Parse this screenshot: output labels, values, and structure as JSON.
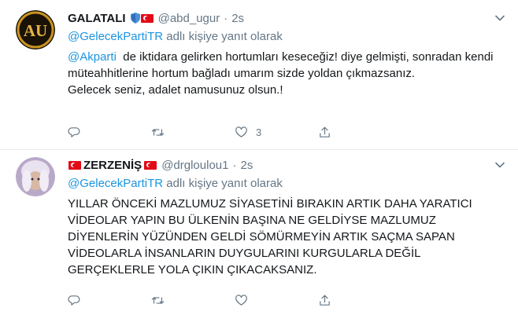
{
  "tweets": [
    {
      "name": "GALATALI",
      "handle": "@abd_ugur",
      "separator": "·",
      "time": "2s",
      "reply_mention": "@GelecekPartiTR",
      "reply_suffix": " adlı kişiye yanıt olarak",
      "text_mention": "@Akparti",
      "text_body": "  de iktidara gelirken hortumları keseceğiz! diye gelmişti, sonradan kendi müteahhitlerine hortum bağladı umarım sizde yoldan çıkmazsanız.\nGelecek seniz, adalet namusunuz olsun.!",
      "avatar_text": "AU",
      "stats": {
        "replies": "",
        "retweets": "",
        "likes": "3"
      }
    },
    {
      "name": "ZERZENİŞ",
      "handle": "@drgloulou1",
      "separator": "·",
      "time": "2s",
      "reply_mention": "@GelecekPartiTR",
      "reply_suffix": " adlı kişiye yanıt olarak",
      "text_body": "YILLAR ÖNCEKİ MAZLUMUZ SİYASETİNİ BIRAKIN ARTIK DAHA YARATICI VİDEOLAR YAPIN BU ÜLKENİN BAŞINA NE GELDİYSE MAZLUMUZ DİYENLERİN YÜZÜNDEN GELDİ SÖMÜRMEYİN ARTIK SAÇMA SAPAN VİDEOLARLA İNSANLARIN DUYGULARINI KURGULARLA DEĞİL GERÇEKLERLE YOLA ÇIKIN ÇIKACAKSANIZ.",
      "stats": {
        "replies": "",
        "retweets": "",
        "likes": ""
      }
    }
  ],
  "colors": {
    "accent": "#1b95e0",
    "muted": "#657786",
    "flag_red": "#e30a17",
    "divider": "#e6ecf0"
  },
  "icons": [
    "reply-icon",
    "retweet-icon",
    "like-icon",
    "share-icon",
    "chevron-down-icon",
    "turkey-flag-icon",
    "shield-icon"
  ]
}
